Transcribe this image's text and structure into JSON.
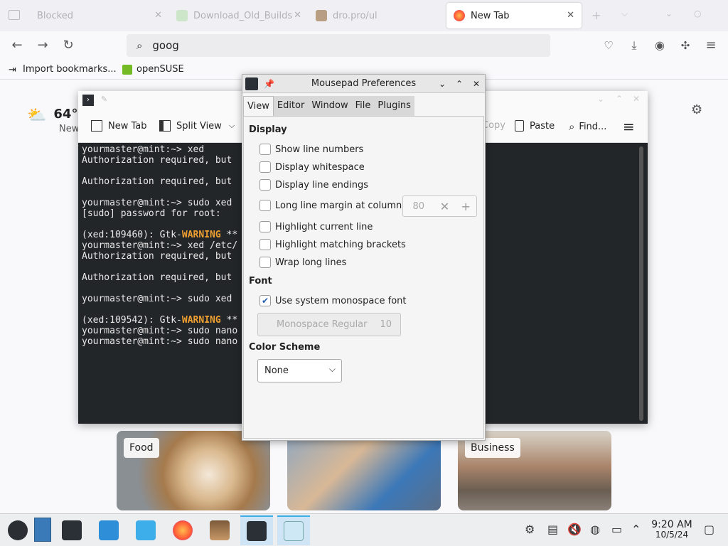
{
  "browser": {
    "tabs": [
      {
        "label": "Blocked",
        "active": false
      },
      {
        "label": "Download_Old_Builds",
        "active": false
      },
      {
        "label": "dro.pro/ul",
        "active": false
      },
      {
        "label": "New Tab",
        "active": true
      }
    ],
    "url_text": "goog",
    "bookmarks": [
      {
        "label": "Import bookmarks..."
      },
      {
        "label": "openSUSE"
      }
    ],
    "weather": {
      "temp": "64°",
      "sub": "New"
    },
    "cards": [
      {
        "label": "Food"
      },
      {
        "label": ""
      },
      {
        "label": "Business"
      }
    ]
  },
  "terminal": {
    "toolbar": {
      "new_tab": "New Tab",
      "split_view": "Split View",
      "copy": "Copy",
      "paste": "Paste",
      "find": "Find..."
    },
    "lines": [
      "yourmaster@mint:~> xed",
      "Authorization required, but",
      "",
      "Authorization required, but",
      "",
      "yourmaster@mint:~> sudo xed",
      "[sudo] password for root:",
      "",
      "(xed:109460): Gtk-|WARNING| **",
      "yourmaster@mint:~> xed /etc/",
      "Authorization required, but",
      "",
      "Authorization required, but",
      "",
      "yourmaster@mint:~> sudo xed",
      "",
      "(xed:109542): Gtk-|WARNING| **",
      "yourmaster@mint:~> sudo nano",
      "yourmaster@mint:~> sudo nano"
    ]
  },
  "prefs": {
    "title": "Mousepad Preferences",
    "tabs": [
      "View",
      "Editor",
      "Window",
      "File",
      "Plugins"
    ],
    "display_heading": "Display",
    "show_line_numbers": "Show line numbers",
    "display_whitespace": "Display whitespace",
    "display_line_endings": "Display line endings",
    "long_line_margin": "Long line margin at column:",
    "margin_value": "80",
    "highlight_current_line": "Highlight current line",
    "highlight_brackets": "Highlight matching brackets",
    "wrap_long_lines": "Wrap long lines",
    "font_heading": "Font",
    "use_system_font": "Use system monospace font",
    "font_name": "Monospace Regular",
    "font_size": "10",
    "color_heading": "Color Scheme",
    "color_scheme_value": "None"
  },
  "taskbar": {
    "time": "9:20 AM",
    "date": "10/5/24"
  },
  "colors": {
    "accent": "#3daee9",
    "terminal_bg": "#232629",
    "warning": "#f0a030"
  }
}
